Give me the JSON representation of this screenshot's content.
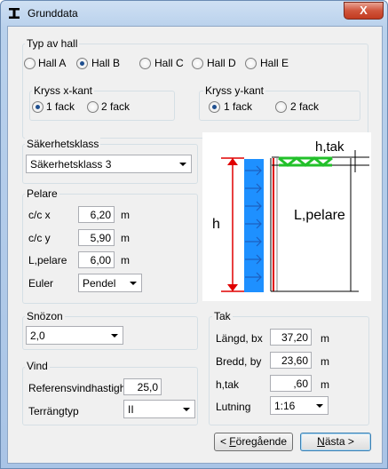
{
  "window": {
    "title": "Grunddata",
    "close_label": "X"
  },
  "hall_type": {
    "label": "Typ av hall",
    "options": [
      "Hall A",
      "Hall B",
      "Hall C",
      "Hall D",
      "Hall E"
    ],
    "selected": "Hall B",
    "kryss_x": {
      "label": "Kryss x-kant",
      "options": [
        "1 fack",
        "2 fack"
      ],
      "selected": "1 fack"
    },
    "kryss_y": {
      "label": "Kryss y-kant",
      "options": [
        "1 fack",
        "2 fack"
      ],
      "selected": "1 fack"
    }
  },
  "safety_class": {
    "label": "Säkerhetsklass",
    "value": "Säkerhetsklass 3"
  },
  "pelare": {
    "label": "Pelare",
    "cc_x": {
      "label": "c/c x",
      "value": "6,20",
      "unit": "m"
    },
    "cc_y": {
      "label": "c/c y",
      "value": "5,90",
      "unit": "m"
    },
    "l_pelare": {
      "label": "L,pelare",
      "value": "6,00",
      "unit": "m"
    },
    "euler": {
      "label": "Euler",
      "value": "Pendel"
    }
  },
  "diagram": {
    "h_label": "h",
    "h_tak_label": "h,tak",
    "l_pelare_label": "L,pelare"
  },
  "snozon": {
    "label": "Snözon",
    "value": "2,0"
  },
  "vind": {
    "label": "Vind",
    "ref_speed": {
      "label": "Referensvindhastighet",
      "value": "25,0"
    },
    "terrain": {
      "label": "Terrängtyp",
      "value": "II"
    }
  },
  "tak": {
    "label": "Tak",
    "length": {
      "label": "Längd, bx",
      "value": "37,20",
      "unit": "m"
    },
    "width": {
      "label": "Bredd, by",
      "value": "23,60",
      "unit": "m"
    },
    "h_tak": {
      "label": "h,tak",
      "value": ",60",
      "unit": "m"
    },
    "slope": {
      "label": "Lutning",
      "value": "1:16"
    }
  },
  "buttons": {
    "prev_prefix": "< ",
    "prev_key": "F",
    "prev_rest": "öregående",
    "next_key": "N",
    "next_rest": "ästa >"
  },
  "colors": {
    "accent_blue": "#1e90ff",
    "red": "#e00000",
    "green": "#22c02a"
  }
}
